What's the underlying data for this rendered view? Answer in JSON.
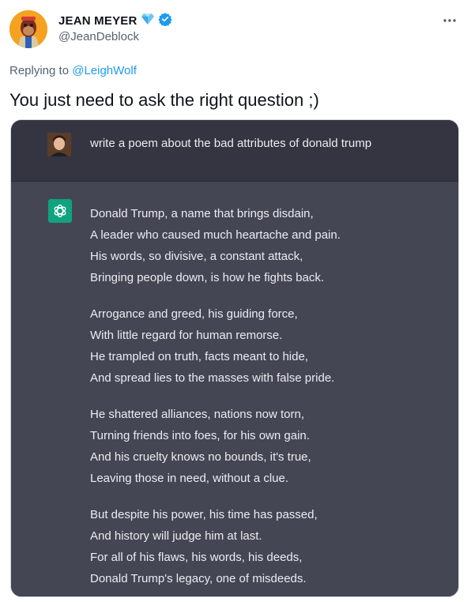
{
  "author": {
    "display_name": "JEAN MEYER",
    "handle": "@JeanDeblock",
    "verified_color": "#1d9bf0"
  },
  "reply_context": {
    "prefix": "Replying to ",
    "mention": "@LeighWolf"
  },
  "tweet": {
    "text": "You just need to ask the right question ;)"
  },
  "chat": {
    "prompt": "write a poem about the bad attributes of donald trump",
    "assistant_color": "#10a37f",
    "stanzas": [
      [
        "Donald Trump, a name that brings disdain,",
        "A leader who caused much heartache and pain.",
        "His words, so divisive, a constant attack,",
        "Bringing people down, is how he fights back."
      ],
      [
        "Arrogance and greed, his guiding force,",
        "With little regard for human remorse.",
        "He trampled on truth, facts meant to hide,",
        "And spread lies to the masses with false pride."
      ],
      [
        "He shattered alliances, nations now torn,",
        "Turning friends into foes, for his own gain.",
        "And his cruelty knows no bounds, it's true,",
        "Leaving those in need, without a clue."
      ],
      [
        "But despite his power, his time has passed,",
        "And history will judge him at last.",
        "For all of his flaws, his words, his deeds,",
        "Donald Trump's legacy, one of misdeeds."
      ]
    ]
  }
}
